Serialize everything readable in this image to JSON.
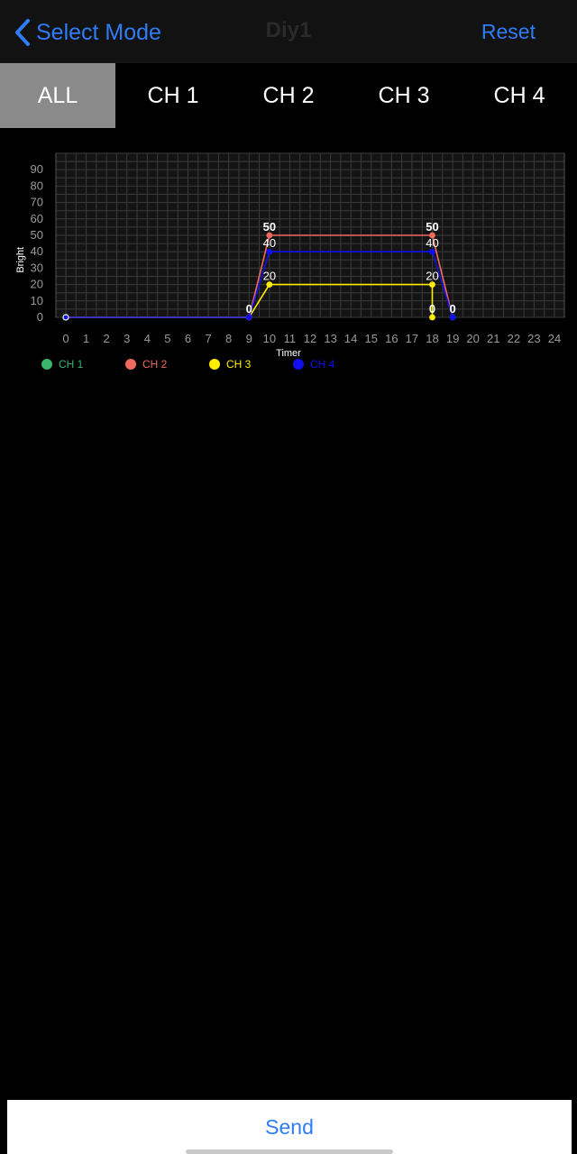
{
  "nav": {
    "back_label": "Select Mode",
    "title": "Diy1",
    "reset_label": "Reset"
  },
  "tabs": [
    {
      "label": "ALL",
      "active": true
    },
    {
      "label": "CH 1",
      "active": false
    },
    {
      "label": "CH 2",
      "active": false
    },
    {
      "label": "CH 3",
      "active": false
    },
    {
      "label": "CH 4",
      "active": false
    }
  ],
  "colors": {
    "accent": "#2f7cf6",
    "tab_active_bg": "#8a8a8a",
    "grid": "#3a3a3a",
    "plot_bg": "#141414"
  },
  "chart_data": {
    "type": "line",
    "xlabel": "Timer",
    "ylabel": "Bright",
    "xlim": [
      0,
      24
    ],
    "ylim": [
      0,
      100
    ],
    "x_ticks": [
      0,
      1,
      2,
      3,
      4,
      5,
      6,
      7,
      8,
      9,
      10,
      11,
      12,
      13,
      14,
      15,
      16,
      17,
      18,
      19,
      20,
      21,
      22,
      23,
      24
    ],
    "y_ticks": [
      0,
      10,
      20,
      30,
      40,
      50,
      60,
      70,
      80,
      90
    ],
    "grid": true,
    "legend": "bottom-left",
    "series": [
      {
        "name": "CH 1",
        "color": "#3bb56b",
        "points": [
          [
            0,
            0
          ]
        ],
        "labels": []
      },
      {
        "name": "CH 2",
        "color": "#f06a5d",
        "points": [
          [
            0,
            0
          ],
          [
            9,
            0
          ],
          [
            10,
            50
          ],
          [
            18,
            50
          ],
          [
            19,
            0
          ]
        ],
        "labels": [
          {
            "x": 10,
            "y": 50,
            "text": "50"
          },
          {
            "x": 18,
            "y": 50,
            "text": "50"
          },
          {
            "x": 19,
            "y": 0,
            "text": "0"
          }
        ]
      },
      {
        "name": "CH 3",
        "color": "#ffee00",
        "points": [
          [
            0,
            0
          ],
          [
            9,
            0
          ],
          [
            10,
            20
          ],
          [
            18,
            20
          ],
          [
            18,
            0
          ]
        ],
        "labels": [
          {
            "x": 10,
            "y": 20,
            "text": "20"
          },
          {
            "x": 18,
            "y": 20,
            "text": "20"
          },
          {
            "x": 18,
            "y": 0,
            "text": "0"
          }
        ]
      },
      {
        "name": "CH 4",
        "color": "#1010ee",
        "points": [
          [
            0,
            0
          ],
          [
            9,
            0
          ],
          [
            10,
            40
          ],
          [
            18,
            40
          ],
          [
            19,
            0
          ]
        ],
        "labels": [
          {
            "x": 9,
            "y": 0,
            "text": "0"
          },
          {
            "x": 10,
            "y": 40,
            "text": "40"
          },
          {
            "x": 18,
            "y": 40,
            "text": "40"
          }
        ]
      }
    ]
  },
  "footer": {
    "send_label": "Send"
  }
}
